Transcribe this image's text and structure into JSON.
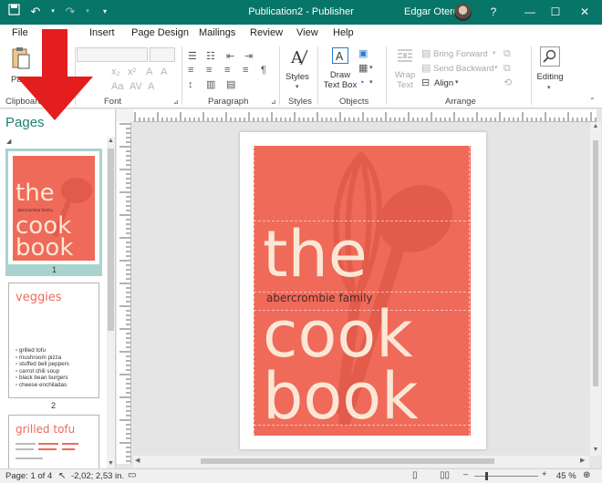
{
  "titlebar": {
    "title": "Publication2  -  Publisher",
    "user": "Edgar Otero",
    "help": "?",
    "minimize": "—",
    "maximize": "☐",
    "close": "✕"
  },
  "menu": {
    "file": "File",
    "insert": "Insert",
    "page_design": "Page Design",
    "mailings": "Mailings",
    "review": "Review",
    "view": "View",
    "help": "Help"
  },
  "ribbon": {
    "clipboard": {
      "label": "Clipboard",
      "paste": "Pa"
    },
    "font": {
      "label": "Font"
    },
    "paragraph": {
      "label": "Paragraph"
    },
    "styles": {
      "label": "Styles",
      "styles_btn": "Styles"
    },
    "objects": {
      "label": "Objects",
      "draw_text_box_line1": "Draw",
      "draw_text_box_line2": "Text Box"
    },
    "arrange": {
      "label": "Arrange",
      "wrap_line1": "Wrap",
      "wrap_line2": "Text",
      "bring_forward": "Bring Forward",
      "send_backward": "Send Backward",
      "align": "Align"
    },
    "editing": {
      "label": "Editing"
    }
  },
  "pages_pane": {
    "title": "Pages",
    "pages": [
      {
        "number": "1",
        "heading": [
          "the",
          "cook",
          "book"
        ],
        "subtitle": "abercrombie family"
      },
      {
        "number": "2",
        "heading": "veggies",
        "items": [
          "grilled tofu",
          "mushroom pizza",
          "stuffed bell peppers",
          "carrot chili soup",
          "black bean burgers",
          "cheese enchiladas"
        ]
      },
      {
        "number": "",
        "heading": "grilled tofu"
      }
    ]
  },
  "cover": {
    "word1": "the",
    "subtitle": "abercrombie family",
    "word2": "cook",
    "word3": "book",
    "colors": {
      "background": "#ef6a59",
      "title_text": "#fbe7d6"
    }
  },
  "statusbar": {
    "page": "Page: 1 of 4",
    "position": "-2,02; 2,53 in.",
    "zoom_minus": "–",
    "zoom_plus": "+",
    "zoom": "45 %"
  },
  "annotation": {
    "arrow_color": "#e41e1e"
  }
}
